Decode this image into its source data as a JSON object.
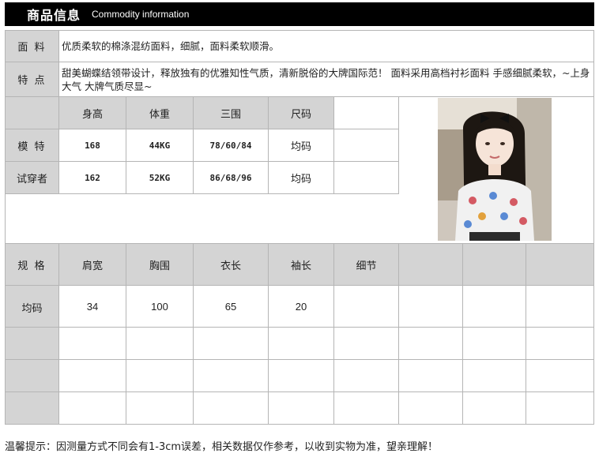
{
  "header": {
    "title_cn": "商品信息",
    "title_en": "Commodity information"
  },
  "fabric": {
    "label": "面 料",
    "text": "优质柔软的棉涤混纺面料，细腻，面料柔软顺滑。"
  },
  "features": {
    "label": "特 点",
    "text": "甜美蝴蝶结领带设计，释放独有的优雅知性气质，清新脱俗的大牌国际范！ 面料采用高档衬衫面料 手感细腻柔软，~上身大气 大牌气质尽显~"
  },
  "model_table": {
    "headers": [
      "身高",
      "体重",
      "三围",
      "尺码"
    ],
    "rows": [
      {
        "label": "模 特",
        "values": [
          "168",
          "44KG",
          "78/60/84",
          "均码"
        ]
      },
      {
        "label": "试穿者",
        "values": [
          "162",
          "52KG",
          "86/68/96",
          "均码"
        ]
      }
    ]
  },
  "size_table": {
    "label": "规 格",
    "headers": [
      "肩宽",
      "胸围",
      "衣长",
      "袖长",
      "细节"
    ],
    "rows": [
      {
        "label": "均码",
        "values": [
          "34",
          "100",
          "65",
          "20"
        ]
      }
    ]
  },
  "tip": "温馨提示：因测量方式不同会有1-3cm误差，相关数据仅作参考，以收到实物为准，望亲理解！"
}
